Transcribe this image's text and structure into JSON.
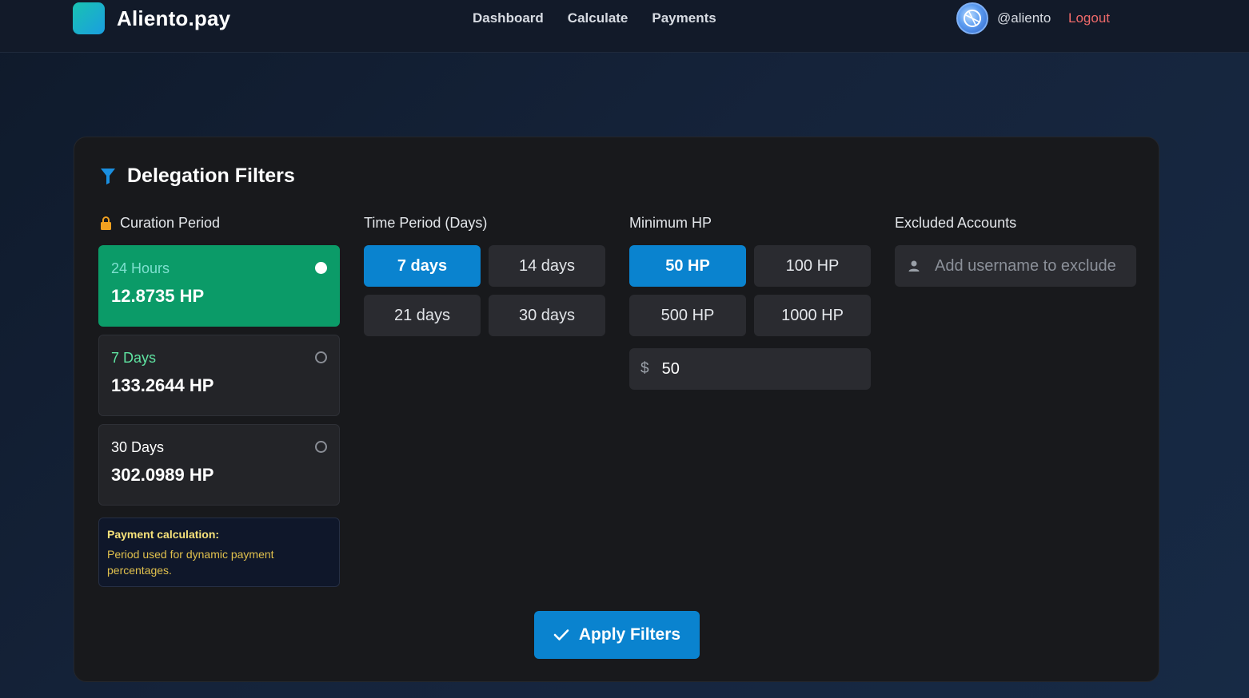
{
  "header": {
    "brand": "Aliento.pay",
    "nav": [
      "Dashboard",
      "Calculate",
      "Payments"
    ],
    "username": "@aliento",
    "logout_label": "Logout"
  },
  "card": {
    "title": "Delegation Filters",
    "curation": {
      "label": "Curation Period",
      "periods": [
        {
          "label": "24 Hours",
          "value": "12.8735 HP",
          "selected": true,
          "label_color": "#7fe0d0"
        },
        {
          "label": "7 Days",
          "value": "133.2644 HP",
          "selected": false,
          "label_color": "#5fe3a1"
        },
        {
          "label": "30 Days",
          "value": "302.0989 HP",
          "selected": false,
          "label_color": "#ffffff"
        }
      ],
      "note_title": "Payment calculation:",
      "note_text": "Period used for dynamic payment percentages."
    },
    "time_period": {
      "label": "Time Period (Days)",
      "options": [
        "7 days",
        "14 days",
        "21 days",
        "30 days"
      ],
      "selected": "7 days"
    },
    "minimum_hp": {
      "label": "Minimum HP",
      "options": [
        "50 HP",
        "100 HP",
        "500 HP",
        "1000 HP"
      ],
      "selected": "50 HP",
      "custom_symbol": "$",
      "custom_value": "50"
    },
    "excluded": {
      "label": "Excluded Accounts",
      "placeholder": "Add username to exclude"
    },
    "apply_label": "Apply Filters"
  },
  "colors": {
    "accent": "#0a83cf",
    "selected_period": "#0b9b68",
    "logout": "#f06a6a",
    "filter_icon": "#1a8fe0",
    "lock_icon": "#f0a020"
  }
}
